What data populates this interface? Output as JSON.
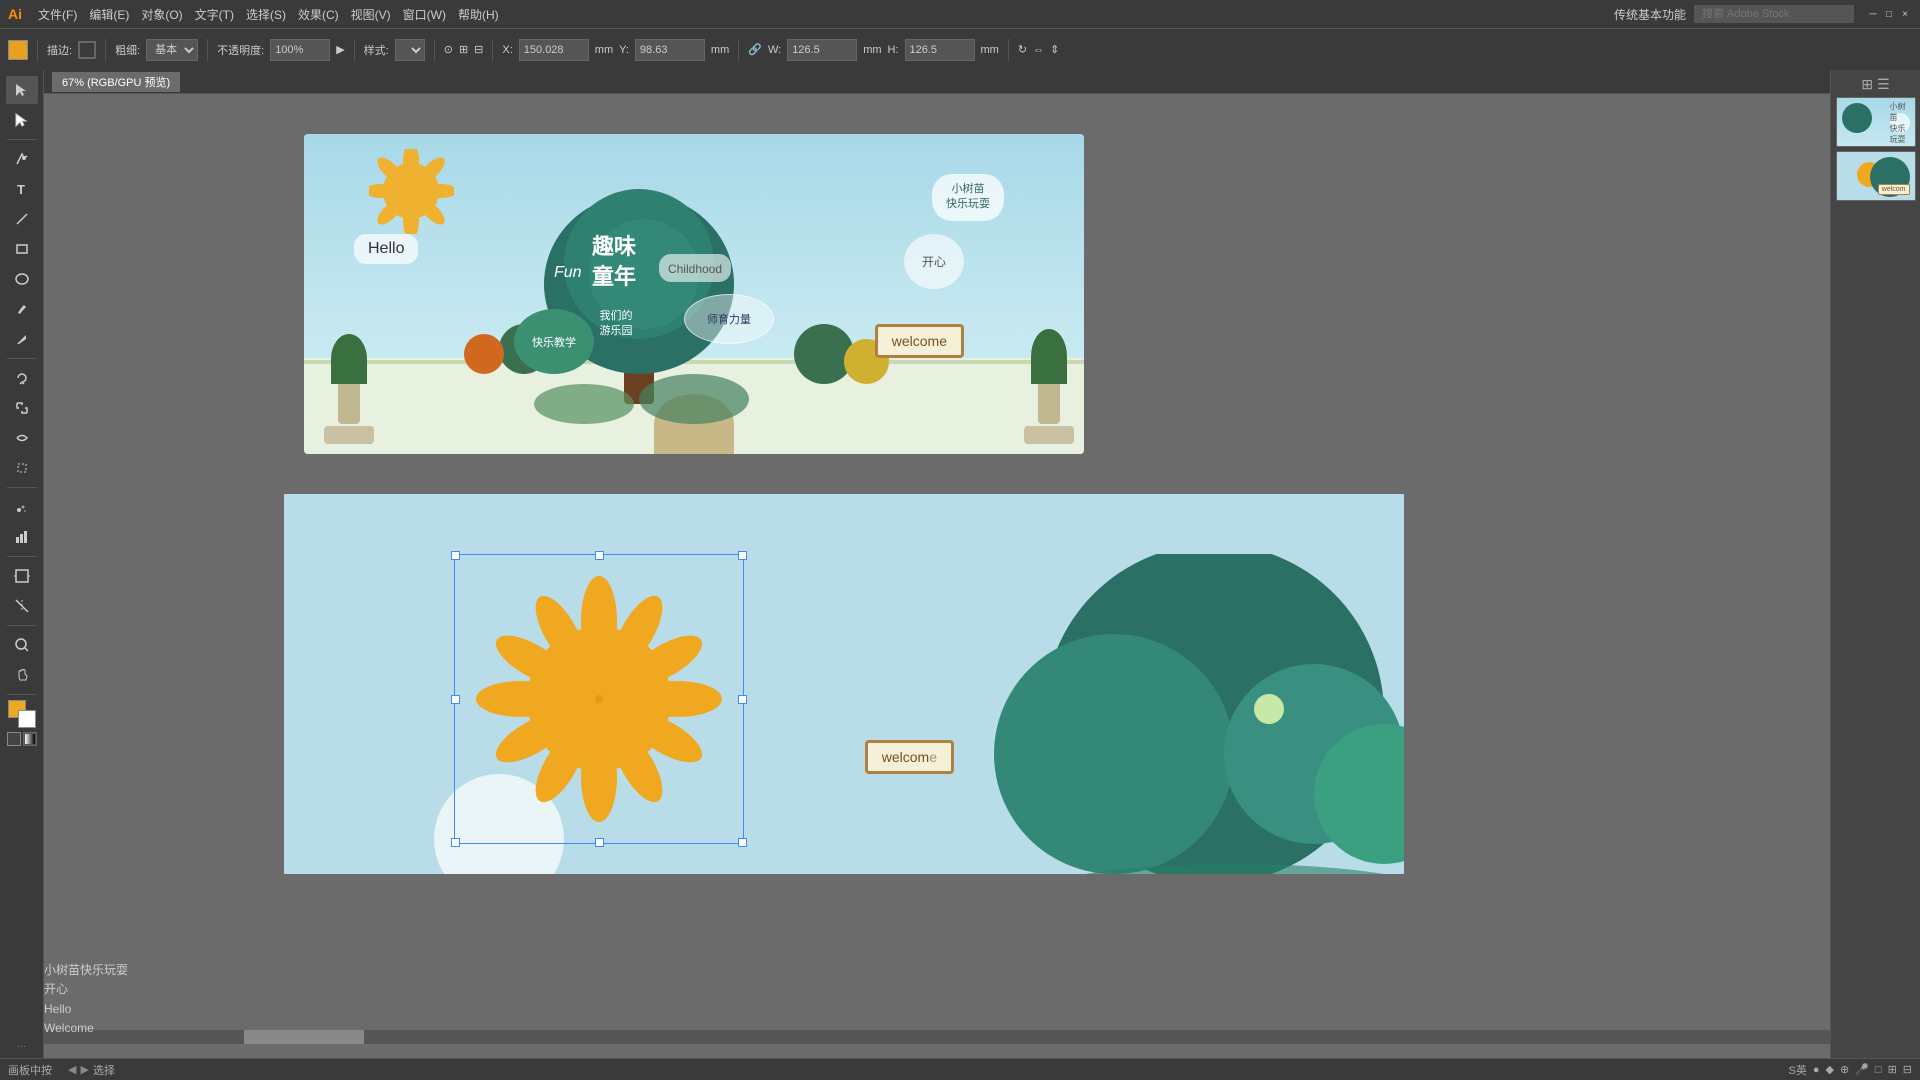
{
  "app": {
    "logo": "Ai",
    "window_title": "传统基本功能",
    "tab_label": "67% (RGB/GPU 预览)"
  },
  "menu": {
    "items": [
      "文件(F)",
      "编辑(E)",
      "对象(O)",
      "文字(T)",
      "选择(S)",
      "效果(C)",
      "视图(V)",
      "窗口(W)",
      "帮助(H)"
    ]
  },
  "toolbar": {
    "fill_color": "#e8a020",
    "stroke_label": "描边:",
    "width_label": "粗细:",
    "opacity_label": "不透明度:",
    "opacity_value": "100%",
    "style_label": "样式:",
    "stroke_weight": "基本",
    "x_label": "X:",
    "x_value": "150.028",
    "y_label": "Y:",
    "y_value": "98.63",
    "unit": "mm",
    "w_label": "W:",
    "w_value": "126.5",
    "h_label": "H:",
    "h_value": "126.5"
  },
  "left_text": {
    "line1": "小树苗快乐玩耍",
    "line2": "开心",
    "line3": "Hello",
    "line4": "Welcome"
  },
  "illustration_top": {
    "title_cn": "趣味",
    "title_cn2": "童年",
    "subtitle": "Childhood",
    "fun_label": "Fun",
    "hello_label": "Hello",
    "cloud1_line1": "小树苗",
    "cloud1_line2": "快乐玩耍",
    "happy_label": "开心",
    "welcome_label": "welcome",
    "teacher_label": "师育力量",
    "happy_study": "快乐教学",
    "my_playground": "我们的\n游乐园"
  },
  "status_bar": {
    "artboard": "画板中按",
    "tool": "选择",
    "right_icons": [
      "S英",
      "●",
      "♦",
      "⊕",
      "□",
      "⊟",
      "▦"
    ]
  },
  "colors": {
    "sky_blue": "#b8dce8",
    "teal_dark": "#2a8070",
    "teal_mid": "#3a9080",
    "sun_orange": "#f0a820",
    "ground_green": "#e8f0e0",
    "welcome_bg": "#f5f0d8",
    "ui_bg": "#3a3a3a",
    "ui_accent": "#5599ff"
  }
}
